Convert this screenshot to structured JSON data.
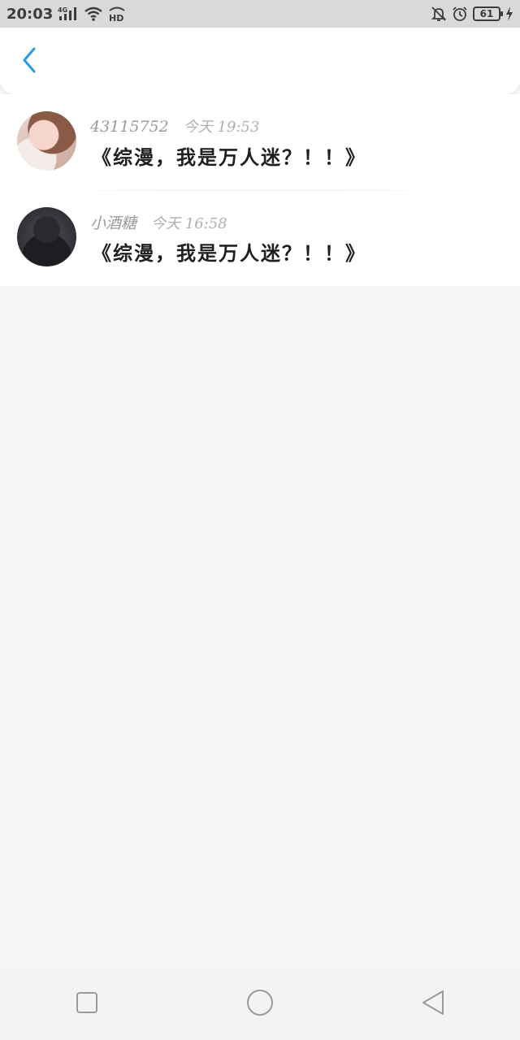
{
  "status_bar": {
    "time": "20:03",
    "network_label": "4G",
    "hd_label": "HD",
    "battery_level": "61",
    "icons": [
      "signal-icon",
      "wifi-icon",
      "hd-icon",
      "mute-bell-icon",
      "alarm-icon",
      "battery-icon",
      "charging-icon"
    ]
  },
  "header": {
    "back_icon": "chevron-left-icon",
    "accent_color": "#2a9ae6"
  },
  "messages": [
    {
      "user": "43115752",
      "time": "今天 19:53",
      "title": "《综漫，我是万人迷？！！》"
    },
    {
      "user": "小酒糖",
      "time": "今天 16:58",
      "title": "《综漫，我是万人迷？！！》"
    }
  ],
  "nav_bar": {
    "icons": [
      "recent-apps-icon",
      "home-icon",
      "back-triangle-icon"
    ]
  }
}
